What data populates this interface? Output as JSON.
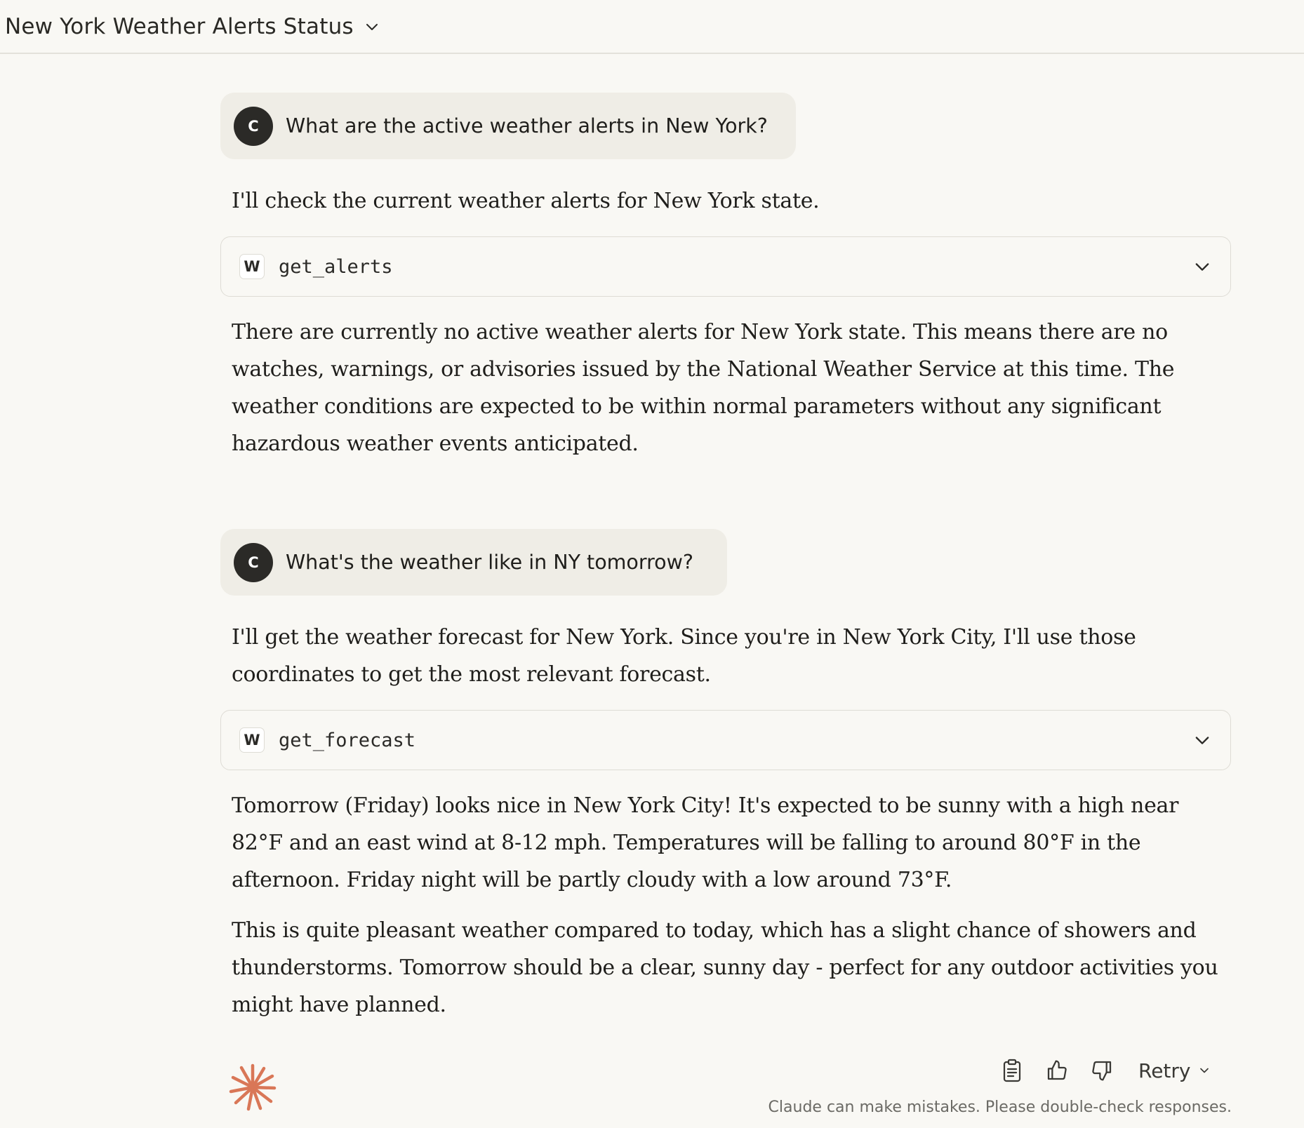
{
  "header": {
    "title": "New York Weather Alerts Status",
    "dropdown_icon": "chevron-down-icon"
  },
  "conversation": [
    {
      "user": {
        "avatar_initial": "C",
        "text": "What are the active weather alerts in New York?"
      },
      "assistant": {
        "intro": "I'll check the current weather alerts for New York state.",
        "tool": {
          "badge": "W",
          "name": "get_alerts"
        },
        "paragraphs": [
          "There are currently no active weather alerts for New York state. This means there are no watches, warnings, or advisories issued by the National Weather Service at this time. The weather conditions are expected to be within normal parameters without any significant hazardous weather events anticipated."
        ]
      }
    },
    {
      "user": {
        "avatar_initial": "C",
        "text": "What's the weather like in NY tomorrow?"
      },
      "assistant": {
        "intro": "I'll get the weather forecast for New York. Since you're in New York City, I'll use those coordinates to get the most relevant forecast.",
        "tool": {
          "badge": "W",
          "name": "get_forecast"
        },
        "paragraphs": [
          "Tomorrow (Friday) looks nice in New York City! It's expected to be sunny with a high near 82°F and an east wind at 8-12 mph. Temperatures will be falling to around 80°F in the afternoon. Friday night will be partly cloudy with a low around 73°F.",
          "This is quite pleasant weather compared to today, which has a slight chance of showers and thunderstorms. Tomorrow should be a clear, sunny day - perfect for any outdoor activities you might have planned."
        ]
      }
    }
  ],
  "footer": {
    "retry_label": "Retry",
    "disclaimer": "Claude can make mistakes. Please double-check responses.",
    "icons": [
      "copy-icon",
      "thumbs-up-icon",
      "thumbs-down-icon"
    ],
    "brand_color": "#d97757"
  }
}
